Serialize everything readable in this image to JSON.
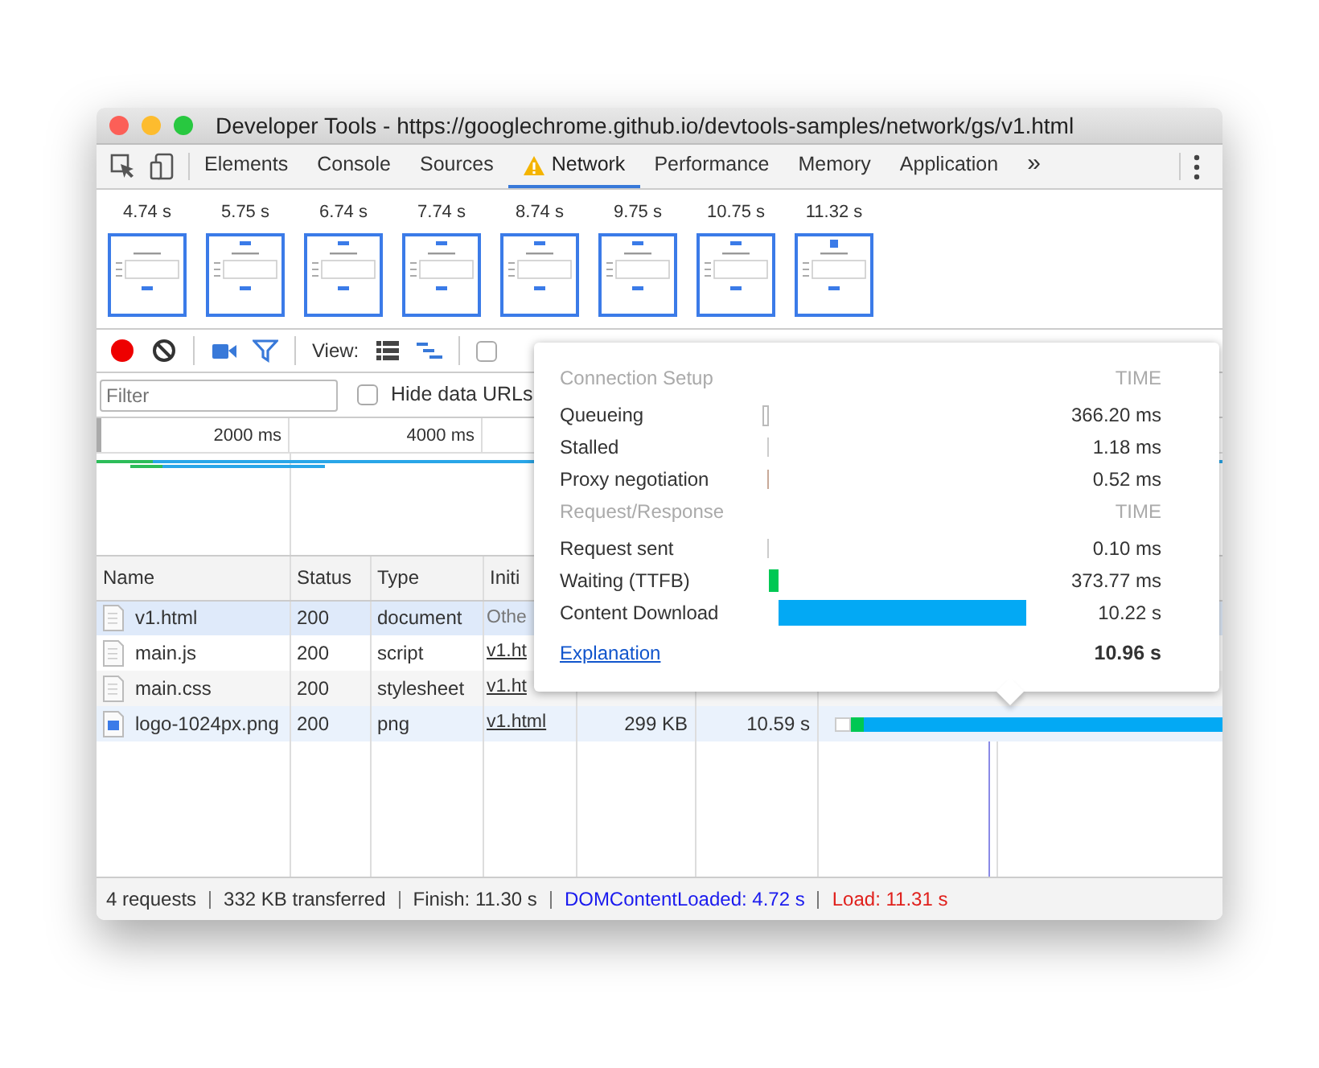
{
  "window": {
    "title": "Developer Tools - https://googlechrome.github.io/devtools-samples/network/gs/v1.html"
  },
  "tabs": [
    {
      "label": "Elements",
      "selected": false,
      "warning": false
    },
    {
      "label": "Console",
      "selected": false,
      "warning": false
    },
    {
      "label": "Sources",
      "selected": false,
      "warning": false
    },
    {
      "label": "Network",
      "selected": true,
      "warning": true
    },
    {
      "label": "Performance",
      "selected": false,
      "warning": false
    },
    {
      "label": "Memory",
      "selected": false,
      "warning": false
    },
    {
      "label": "Application",
      "selected": false,
      "warning": false
    }
  ],
  "more_tabs": "»",
  "filmstrip": [
    {
      "time": "4.74 s"
    },
    {
      "time": "5.75 s"
    },
    {
      "time": "6.74 s"
    },
    {
      "time": "7.74 s"
    },
    {
      "time": "8.74 s"
    },
    {
      "time": "9.75 s"
    },
    {
      "time": "10.75 s"
    },
    {
      "time": "11.32 s"
    }
  ],
  "toolbar": {
    "recording": true,
    "screenshots": true,
    "filter_shown": true,
    "view_label": "View:",
    "view_modes": [
      {
        "kind": "list",
        "selected": false
      },
      {
        "kind": "waterfall",
        "selected": true
      }
    ],
    "option_checkbox": {
      "checked": false
    }
  },
  "filter": {
    "placeholder": "Filter",
    "hide_data_urls": {
      "label": "Hide data URLs",
      "checked": false
    }
  },
  "overview": {
    "ticks": [
      "2000 ms",
      "4000 ms"
    ]
  },
  "table": {
    "columns": [
      "Name",
      "Status",
      "Type",
      "Initi"
    ],
    "rows": [
      {
        "name": "v1.html",
        "kind": "document",
        "status": "200",
        "type": "document",
        "initiator": "Othe",
        "initiator_link": false,
        "selected": true,
        "highlighted": false
      },
      {
        "name": "main.js",
        "kind": "document",
        "status": "200",
        "type": "script",
        "initiator": "v1.ht",
        "initiator_link": true,
        "selected": false,
        "highlighted": false
      },
      {
        "name": "main.css",
        "kind": "document",
        "status": "200",
        "type": "stylesheet",
        "initiator": "v1.ht",
        "initiator_link": true,
        "selected": false,
        "highlighted": false
      },
      {
        "name": "logo-1024px.png",
        "kind": "image",
        "status": "200",
        "type": "png",
        "initiator": "v1.html",
        "initiator_link": true,
        "size": "299 KB",
        "time": "10.59 s",
        "selected": false,
        "highlighted": true
      }
    ]
  },
  "tooltip": {
    "sections": [
      {
        "title": "Connection Setup",
        "time_header": "TIME",
        "rows": [
          {
            "label": "Queueing",
            "value": "366.20 ms",
            "color": "#ffffff"
          },
          {
            "label": "Stalled",
            "value": "1.18 ms",
            "color": "#cccccc"
          },
          {
            "label": "Proxy negotiation",
            "value": "0.52 ms",
            "color": "#c8a998"
          }
        ]
      },
      {
        "title": "Request/Response",
        "time_header": "TIME",
        "rows": [
          {
            "label": "Request sent",
            "value": "0.10 ms",
            "color": "#cccccc"
          },
          {
            "label": "Waiting (TTFB)",
            "value": "373.77 ms",
            "color": "#00c853"
          },
          {
            "label": "Content Download",
            "value": "10.22 s",
            "color": "#03a9f4"
          }
        ]
      }
    ],
    "explanation": "Explanation",
    "total": "10.96 s"
  },
  "status_bar": [
    {
      "text": "4 requests",
      "kind": "normal"
    },
    {
      "text": "332 KB transferred",
      "kind": "normal"
    },
    {
      "text": "Finish: 11.30 s",
      "kind": "normal"
    },
    {
      "text": "DOMContentLoaded: 4.72 s",
      "kind": "dcl"
    },
    {
      "text": "Load: 11.31 s",
      "kind": "load"
    }
  ]
}
